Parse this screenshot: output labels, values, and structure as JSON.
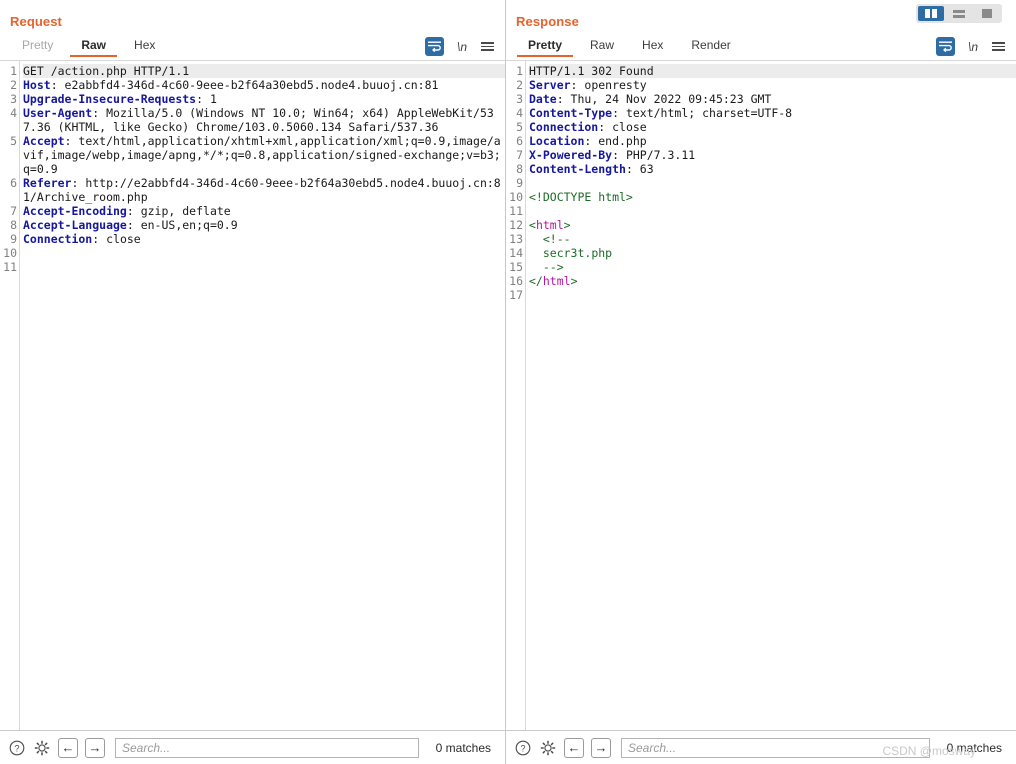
{
  "request": {
    "title": "Request",
    "tabs": [
      {
        "label": "Pretty",
        "state": "dim"
      },
      {
        "label": "Raw",
        "state": "active"
      },
      {
        "label": "Hex",
        "state": "normal"
      }
    ],
    "tools": {
      "wrap_icon": "word-wrap-icon",
      "newline_label": "\\n",
      "menu_icon": "hamburger-menu-icon"
    },
    "line_numbers": [
      "1",
      "2",
      "3",
      "4",
      "5",
      "6",
      "7",
      "8",
      "9",
      "10",
      "11"
    ],
    "lines": [
      {
        "n": 1,
        "highlight": true,
        "parts": [
          {
            "t": "val",
            "s": "GET /action.php HTTP/1.1"
          }
        ]
      },
      {
        "n": 2,
        "parts": [
          {
            "t": "hdr",
            "s": "Host"
          },
          {
            "t": "val",
            "s": ": e2abbfd4-346d-4c60-9eee-b2f64a30ebd5.node4.buuoj.cn:81"
          }
        ]
      },
      {
        "n": 3,
        "parts": [
          {
            "t": "hdr",
            "s": "Upgrade-Insecure-Requests"
          },
          {
            "t": "val",
            "s": ": 1"
          }
        ]
      },
      {
        "n": 4,
        "parts": [
          {
            "t": "hdr",
            "s": "User-Agent"
          },
          {
            "t": "val",
            "s": ": Mozilla/5.0 (Windows NT 10.0; Win64; x64) AppleWebKit/537.36 (KHTML, like Gecko) Chrome/103.0.5060.134 Safari/537.36"
          }
        ]
      },
      {
        "n": 5,
        "parts": [
          {
            "t": "hdr",
            "s": "Accept"
          },
          {
            "t": "val",
            "s": ": text/html,application/xhtml+xml,application/xml;q=0.9,image/avif,image/webp,image/apng,*/*;q=0.8,application/signed-exchange;v=b3;q=0.9"
          }
        ]
      },
      {
        "n": 6,
        "parts": [
          {
            "t": "hdr",
            "s": "Referer"
          },
          {
            "t": "val",
            "s": ": http://e2abbfd4-346d-4c60-9eee-b2f64a30ebd5.node4.buuoj.cn:81/Archive_room.php"
          }
        ]
      },
      {
        "n": 7,
        "parts": [
          {
            "t": "hdr",
            "s": "Accept-Encoding"
          },
          {
            "t": "val",
            "s": ": gzip, deflate"
          }
        ]
      },
      {
        "n": 8,
        "parts": [
          {
            "t": "hdr",
            "s": "Accept-Language"
          },
          {
            "t": "val",
            "s": ": en-US,en;q=0.9"
          }
        ]
      },
      {
        "n": 9,
        "parts": [
          {
            "t": "hdr",
            "s": "Connection"
          },
          {
            "t": "val",
            "s": ": close"
          }
        ]
      },
      {
        "n": 10,
        "parts": []
      },
      {
        "n": 11,
        "parts": []
      }
    ],
    "bottom": {
      "help_icon": "question-mark-icon",
      "settings_icon": "gear-icon",
      "prev_icon": "arrow-left-icon",
      "next_icon": "arrow-right-icon",
      "search_value": "",
      "search_placeholder": "Search...",
      "matches": "0 matches"
    }
  },
  "response": {
    "title": "Response",
    "layout_buttons": [
      {
        "name": "layout-side-by-side",
        "state": "active"
      },
      {
        "name": "layout-stacked",
        "state": "normal"
      },
      {
        "name": "layout-single",
        "state": "normal"
      }
    ],
    "tabs": [
      {
        "label": "Pretty",
        "state": "active"
      },
      {
        "label": "Raw",
        "state": "normal"
      },
      {
        "label": "Hex",
        "state": "normal"
      },
      {
        "label": "Render",
        "state": "normal"
      }
    ],
    "tools": {
      "wrap_icon": "word-wrap-icon",
      "newline_label": "\\n",
      "menu_icon": "hamburger-menu-icon"
    },
    "line_numbers": [
      "1",
      "2",
      "3",
      "4",
      "5",
      "6",
      "7",
      "8",
      "9",
      "10",
      "11",
      "12",
      "13",
      "14",
      "15",
      "16",
      "17"
    ],
    "lines": [
      {
        "n": 1,
        "highlight": true,
        "parts": [
          {
            "t": "val",
            "s": "HTTP/1.1 302 Found"
          }
        ]
      },
      {
        "n": 2,
        "parts": [
          {
            "t": "hdr",
            "s": "Server"
          },
          {
            "t": "val",
            "s": ": openresty"
          }
        ]
      },
      {
        "n": 3,
        "parts": [
          {
            "t": "hdr",
            "s": "Date"
          },
          {
            "t": "val",
            "s": ": Thu, 24 Nov 2022 09:45:23 GMT"
          }
        ]
      },
      {
        "n": 4,
        "parts": [
          {
            "t": "hdr",
            "s": "Content-Type"
          },
          {
            "t": "val",
            "s": ": text/html; charset=UTF-8"
          }
        ]
      },
      {
        "n": 5,
        "parts": [
          {
            "t": "hdr",
            "s": "Connection"
          },
          {
            "t": "val",
            "s": ": close"
          }
        ]
      },
      {
        "n": 6,
        "parts": [
          {
            "t": "hdr",
            "s": "Location"
          },
          {
            "t": "val",
            "s": ": end.php"
          }
        ]
      },
      {
        "n": 7,
        "parts": [
          {
            "t": "hdr",
            "s": "X-Powered-By"
          },
          {
            "t": "val",
            "s": ": PHP/7.3.11"
          }
        ]
      },
      {
        "n": 8,
        "parts": [
          {
            "t": "hdr",
            "s": "Content-Length"
          },
          {
            "t": "val",
            "s": ": 63"
          }
        ]
      },
      {
        "n": 9,
        "parts": []
      },
      {
        "n": 10,
        "parts": [
          {
            "t": "doctype",
            "s": "<!DOCTYPE html>"
          }
        ]
      },
      {
        "n": 11,
        "parts": []
      },
      {
        "n": 12,
        "parts": [
          {
            "t": "brk",
            "s": "<"
          },
          {
            "t": "tagname",
            "s": "html"
          },
          {
            "t": "brk",
            "s": ">"
          }
        ]
      },
      {
        "n": 13,
        "parts": [
          {
            "t": "comment",
            "s": "  <!--"
          }
        ]
      },
      {
        "n": 14,
        "parts": [
          {
            "t": "comment",
            "s": "  secr3t.php"
          }
        ]
      },
      {
        "n": 15,
        "parts": [
          {
            "t": "comment",
            "s": "  -->"
          }
        ]
      },
      {
        "n": 16,
        "parts": [
          {
            "t": "brk",
            "s": "</"
          },
          {
            "t": "tagname",
            "s": "html"
          },
          {
            "t": "brk",
            "s": ">"
          }
        ]
      },
      {
        "n": 17,
        "parts": []
      }
    ],
    "bottom": {
      "help_icon": "question-mark-icon",
      "settings_icon": "gear-icon",
      "prev_icon": "arrow-left-icon",
      "next_icon": "arrow-right-icon",
      "search_value": "",
      "search_placeholder": "Search...",
      "matches": "0 matches"
    }
  },
  "watermark": "CSDN @mosway",
  "colors": {
    "accent": "#e8622c",
    "active_blue": "#2d6da3",
    "header_name": "#16179c",
    "tag_name": "#b5179e",
    "markup_green": "#1d6b28"
  }
}
